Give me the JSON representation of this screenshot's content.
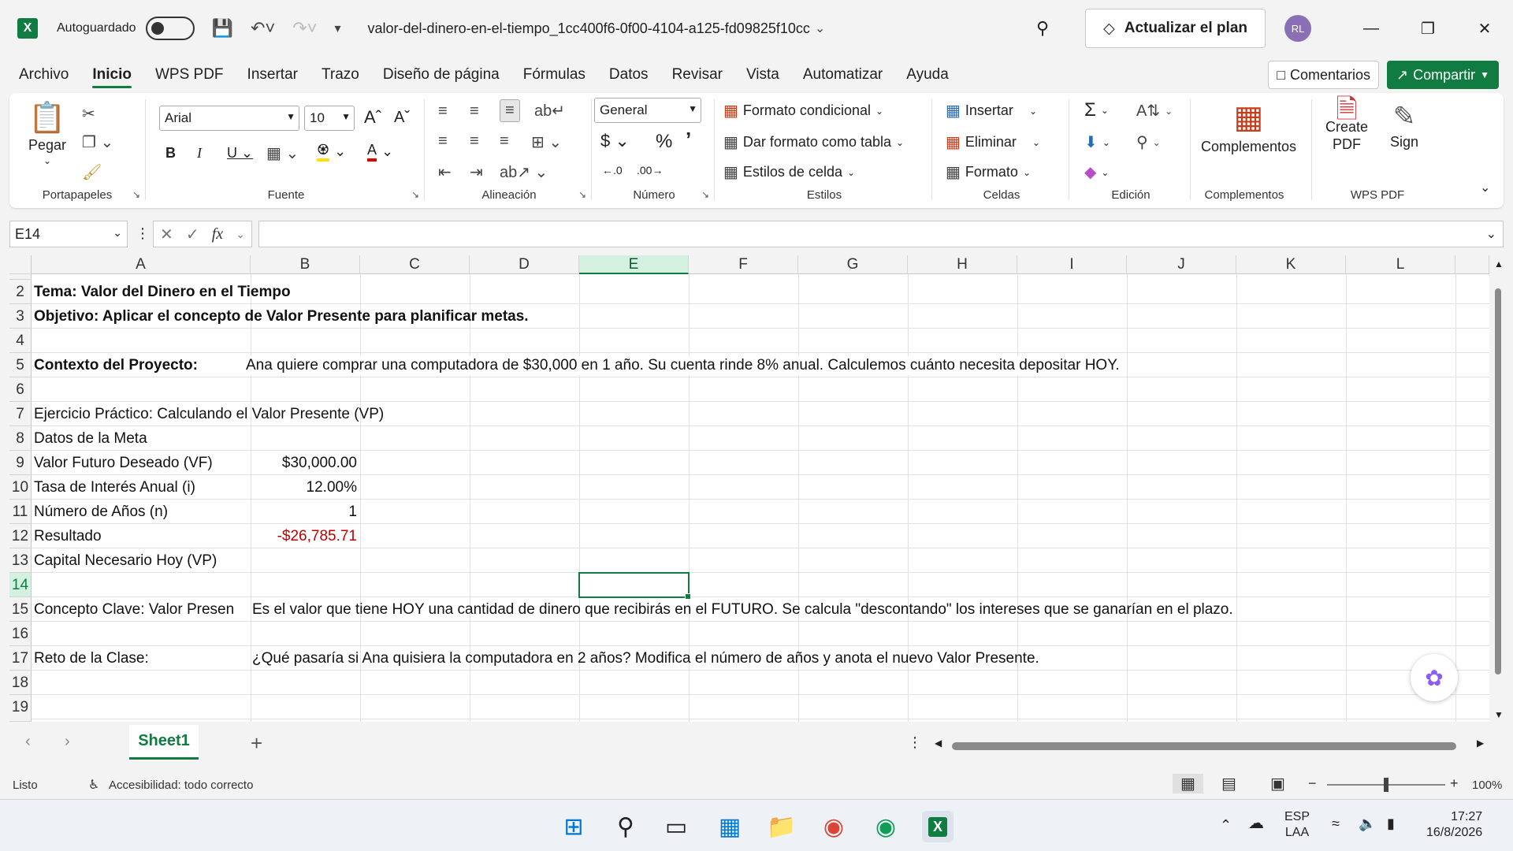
{
  "titlebar": {
    "autosave_label": "Autoguardado",
    "doc_title": "valor-del-dinero-en-el-tiempo_1cc400f6-0f00-4104-a125-fd09825f10cc",
    "upgrade_label": "Actualizar el plan",
    "avatar_initials": "RL"
  },
  "menu": {
    "tabs": [
      "Archivo",
      "Inicio",
      "WPS PDF",
      "Insertar",
      "Trazo",
      "Diseño de página",
      "Fórmulas",
      "Datos",
      "Revisar",
      "Vista",
      "Automatizar",
      "Ayuda"
    ],
    "active": "Inicio",
    "comments_label": "Comentarios",
    "share_label": "Compartir"
  },
  "ribbon": {
    "clipboard": {
      "paste_label": "Pegar",
      "group_label": "Portapapeles"
    },
    "font": {
      "font_name": "Arial",
      "font_size": "10",
      "group_label": "Fuente"
    },
    "alignment": {
      "group_label": "Alineación"
    },
    "number": {
      "format": "General",
      "group_label": "Número"
    },
    "styles": {
      "conditional": "Formato condicional",
      "as_table": "Dar formato como tabla",
      "cell_styles": "Estilos de celda",
      "group_label": "Estilos"
    },
    "cells": {
      "insert": "Insertar",
      "delete": "Eliminar",
      "format": "Formato",
      "group_label": "Celdas"
    },
    "editing": {
      "group_label": "Edición"
    },
    "addins": {
      "label": "Complementos",
      "group_label": "Complementos"
    },
    "wpspdf": {
      "create_line1": "Create",
      "create_line2": "PDF",
      "sign": "Sign",
      "group_label": "WPS PDF"
    }
  },
  "formula": {
    "namebox": "E14",
    "content": ""
  },
  "columns": [
    "A",
    "B",
    "C",
    "D",
    "E",
    "F",
    "G",
    "H",
    "I",
    "J",
    "K",
    "L"
  ],
  "selected_column": "E",
  "rows": [
    "2",
    "3",
    "4",
    "5",
    "6",
    "7",
    "8",
    "9",
    "10",
    "11",
    "12",
    "13",
    "14",
    "15",
    "16",
    "17",
    "18",
    "19"
  ],
  "selected_row": "14",
  "cells": {
    "A2": "Tema: Valor del Dinero en el Tiempo",
    "A3": "Objetivo: Aplicar el concepto de Valor Presente para planificar metas.",
    "A5": "Contexto del Proyecto:",
    "B5": "Ana quiere comprar una computadora de $30,000 en 1 año. Su cuenta rinde 8% anual. Calculemos cuánto necesita depositar HOY.",
    "A7": "Ejercicio Práctico: Calculando el Valor Presente (VP)",
    "A8": "Datos de la Meta",
    "A9": "Valor Futuro Deseado (VF)",
    "B9": "$30,000.00",
    "A10": "Tasa de Interés Anual (i)",
    "B10": "12.00%",
    "A11": "Número de Años (n)",
    "B11": "1",
    "A12": "Resultado",
    "B12": "-$26,785.71",
    "A13": "Capital Necesario Hoy (VP)",
    "A15": "Concepto Clave: Valor Presen",
    "B15": "Es el valor que tiene HOY una cantidad de dinero que recibirás en el FUTURO. Se calcula \"descontando\" los intereses que se ganarían en el plazo.",
    "A17": "Reto de la Clase:",
    "B17": "¿Qué pasaría si Ana quisiera la computadora en 2 años? Modifica el número de años y anota el nuevo Valor Presente."
  },
  "sheets": [
    "Sheet1"
  ],
  "status": {
    "mode": "Listo",
    "accessibility": "Accesibilidad: todo correcto",
    "zoom": "100%"
  },
  "taskbar": {
    "lang_line1": "ESP",
    "lang_line2": "LAA",
    "time": "17:27",
    "date": "16/8/2026"
  },
  "colors": {
    "accent": "#107c41",
    "negative": "#c00000"
  }
}
